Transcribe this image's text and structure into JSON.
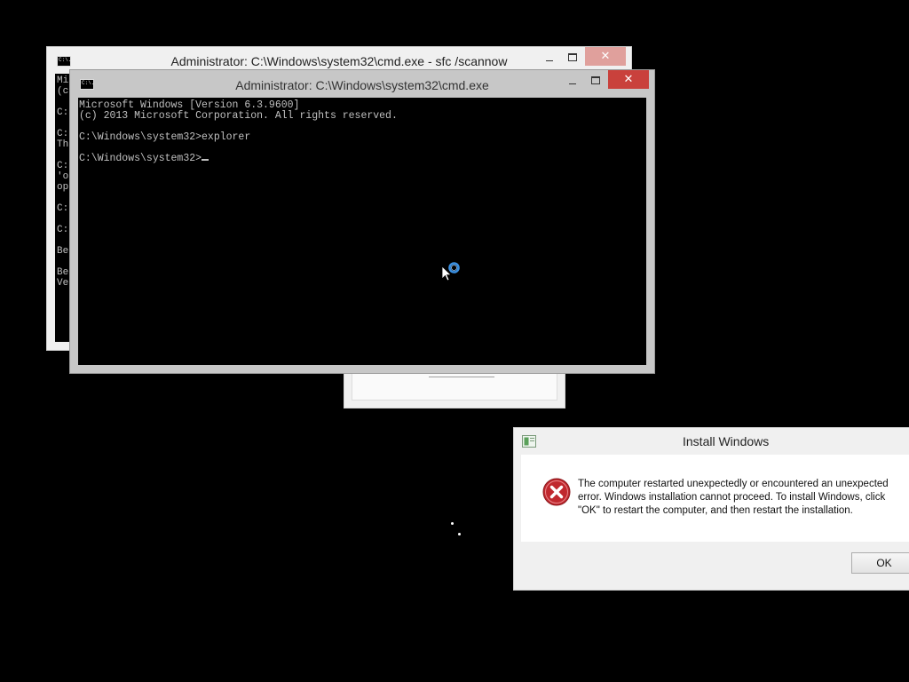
{
  "cmd_back": {
    "title": "Administrator: C:\\Windows\\system32\\cmd.exe - sfc  /scannow",
    "icon_label": "C:\\.",
    "visible_lines": [
      "Mi",
      "(c",
      "",
      "C:",
      "",
      "C:",
      "Th",
      "",
      "C:",
      "'o",
      "op",
      "",
      "C:",
      "",
      "C:",
      "",
      "Be",
      "",
      "Be",
      "Ve"
    ]
  },
  "cmd_front": {
    "title": "Administrator: C:\\Windows\\system32\\cmd.exe",
    "icon_label": "C:\\.",
    "lines": [
      "Microsoft Windows [Version 6.3.9600]",
      "(c) 2013 Microsoft Corporation. All rights reserved.",
      "",
      "C:\\Windows\\system32>explorer",
      ""
    ],
    "prompt": "C:\\Windows\\system32>"
  },
  "install_dialog": {
    "title": "Install Windows",
    "message": "The computer restarted unexpectedly or encountered an unexpected error. Windows installation cannot proceed. To install Windows, click \"OK\" to restart the computer, and then restart the installation.",
    "ok_label": "OK",
    "icon": "error-icon"
  },
  "colors": {
    "desktop": "#000000",
    "close_button": "#c9413c",
    "close_button_inactive": "#e0a09c",
    "error_red": "#c0282e",
    "busy_ring": "#3a8fe0"
  }
}
